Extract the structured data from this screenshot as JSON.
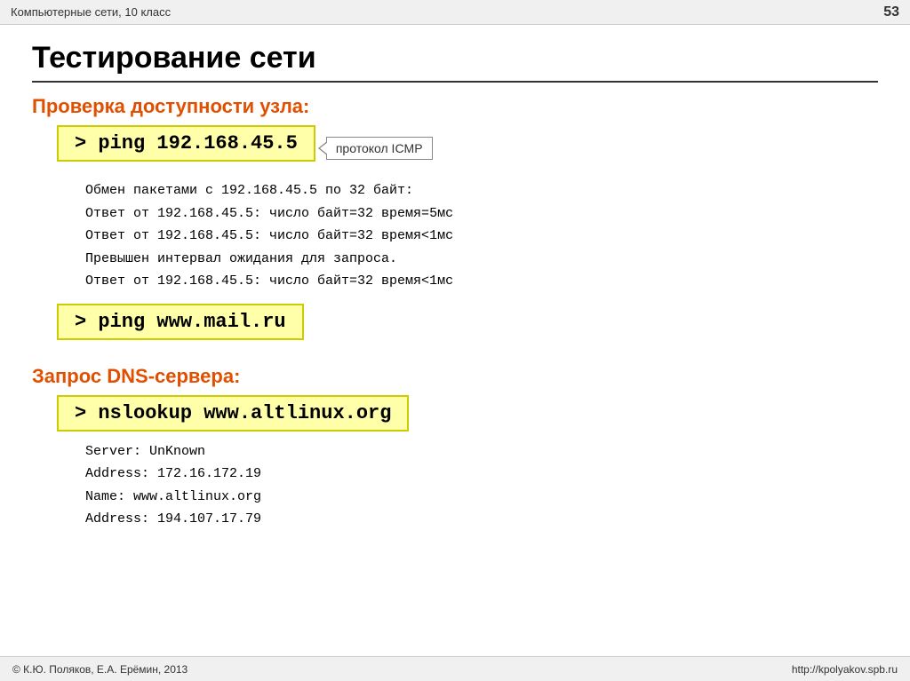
{
  "header": {
    "title": "Компьютерные сети, 10 класс",
    "page_number": "53"
  },
  "page_title": "Тестирование сети",
  "section1": {
    "heading": "Проверка доступности узла:",
    "command1": "> ping 192.168.45.5",
    "tooltip": "протокол ICMP",
    "output_lines": [
      "Обмен пакетами с 192.168.45.5 по 32 байт:",
      "Ответ от 192.168.45.5: число байт=32 время=5мс",
      "Ответ от 192.168.45.5: число байт=32 время<1мс",
      "Превышен интервал ожидания для запроса.",
      "Ответ от 192.168.45.5: число байт=32 время<1мс"
    ],
    "command2": "> ping www.mail.ru"
  },
  "section2": {
    "heading": "Запрос DNS-сервера:",
    "command": "> nslookup www.altlinux.org",
    "output_lines": [
      {
        "label": "Server:  ",
        "value": "UnKnown"
      },
      {
        "label": "Address: ",
        "value": "172.16.172.19"
      },
      {
        "label": "Name:    ",
        "value": "www.altlinux.org"
      },
      {
        "label": "Address: ",
        "value": "194.107.17.79"
      }
    ]
  },
  "footer": {
    "left": "© К.Ю. Поляков, Е.А. Ерёмин, 2013",
    "right": "http://kpolyakov.spb.ru"
  }
}
